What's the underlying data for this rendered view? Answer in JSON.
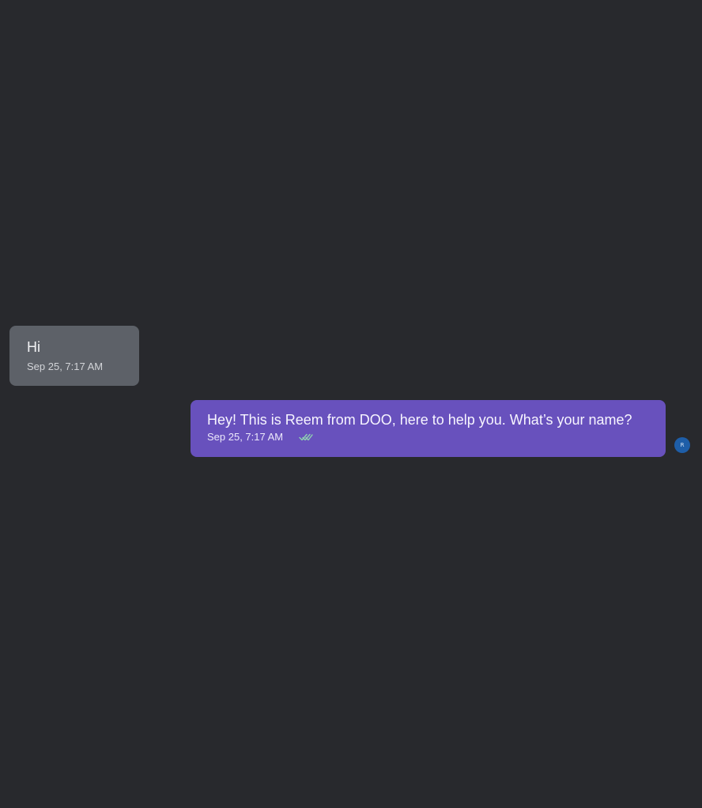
{
  "conversation": {
    "messages": [
      {
        "direction": "incoming",
        "text": "Hi",
        "timestamp": "Sep 25, 7:17 AM"
      },
      {
        "direction": "outgoing",
        "text": "Hey! This is Reem from DOO, here to help you. What’s your name?",
        "timestamp": "Sep 25, 7:17 AM",
        "status_icon": "double-check-icon",
        "sender_avatar_initial": "R"
      }
    ]
  },
  "colors": {
    "background": "#28292d",
    "incoming_bubble": "#5d6168",
    "outgoing_bubble": "#6851bd",
    "avatar": "#1e5ea8",
    "read_check": "#8fd3b0"
  }
}
